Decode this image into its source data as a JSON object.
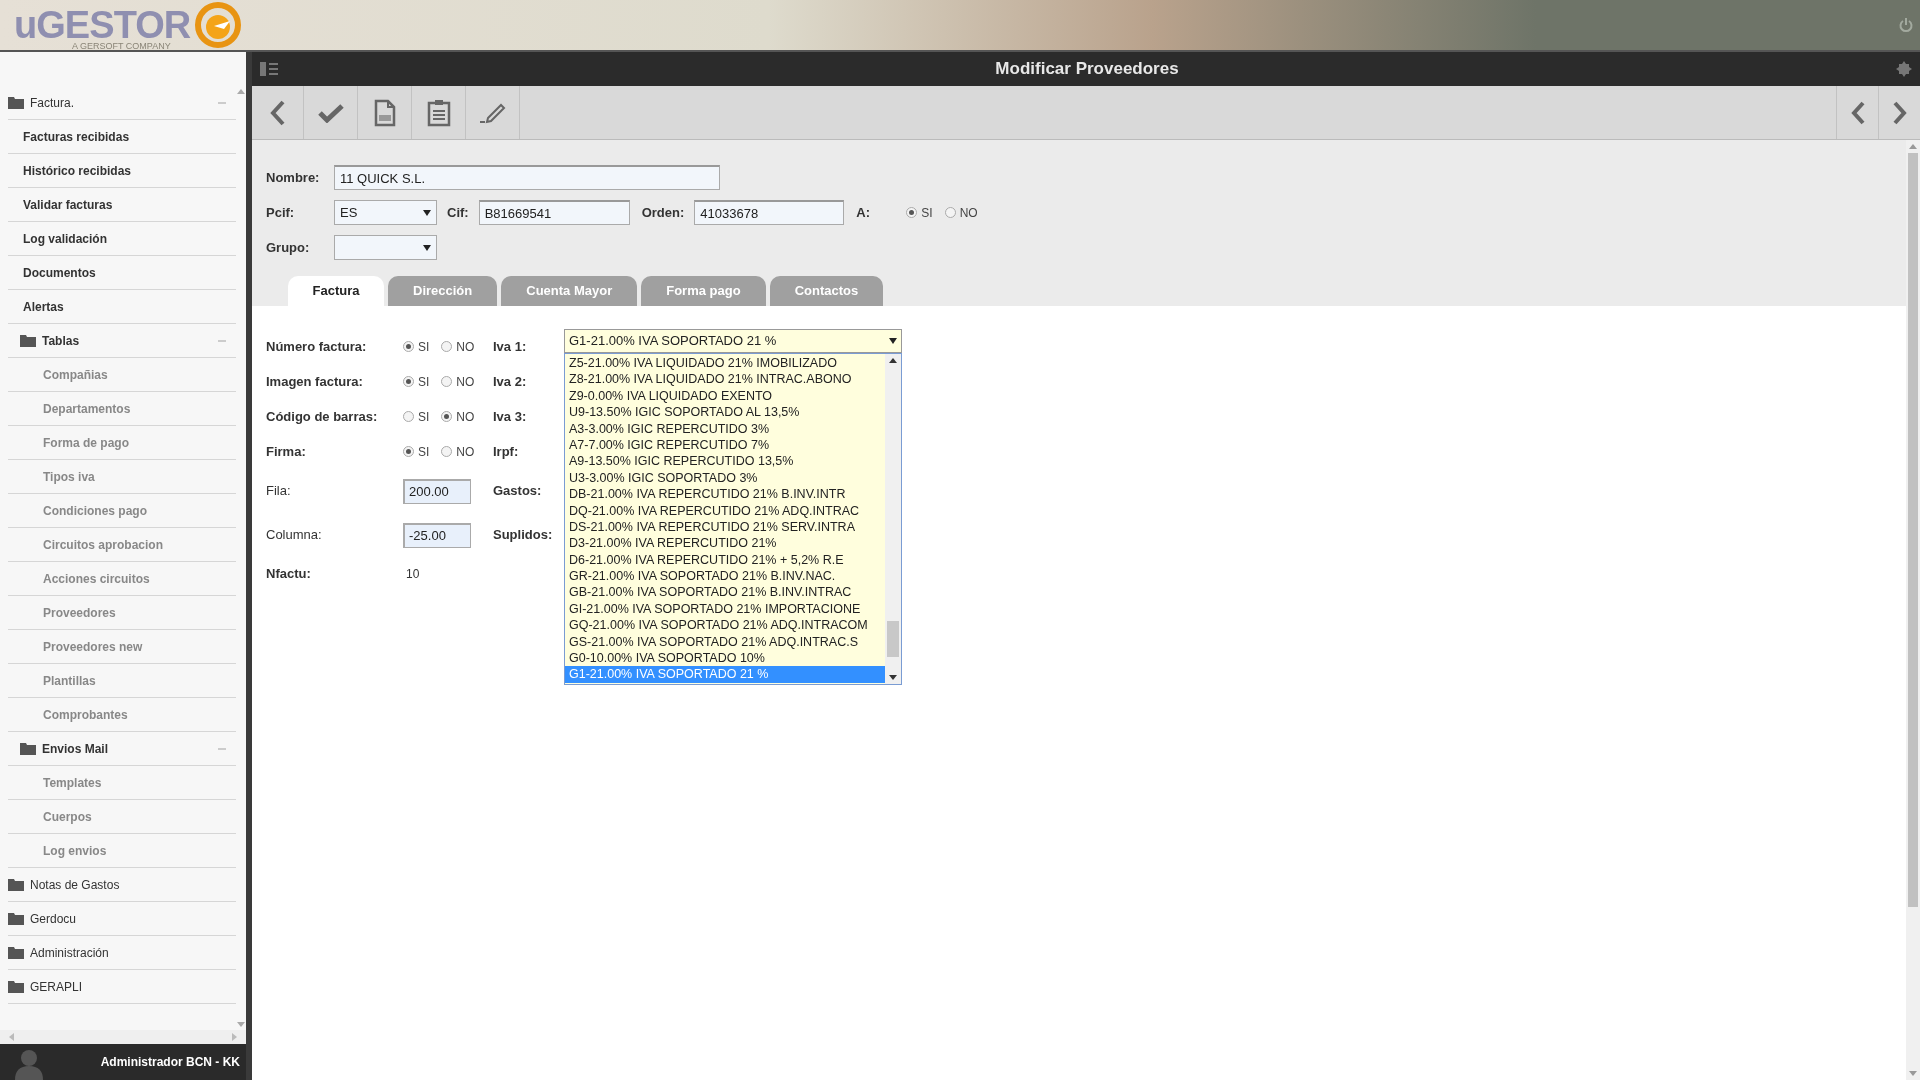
{
  "header": {
    "logo_text": "uGESTOR",
    "tagline": "A GERSOFT COMPANY"
  },
  "sidebar": {
    "items": [
      {
        "kind": "folder",
        "label": "Factura.",
        "expanded": true,
        "children": [
          {
            "kind": "item",
            "label": "Facturas recibidas"
          },
          {
            "kind": "item",
            "label": "Histórico recibidas"
          },
          {
            "kind": "item",
            "label": "Validar facturas"
          },
          {
            "kind": "item",
            "label": "Log validación"
          },
          {
            "kind": "item",
            "label": "Documentos"
          },
          {
            "kind": "item",
            "label": "Alertas"
          },
          {
            "kind": "folder",
            "label": "Tablas",
            "expanded": true,
            "children": [
              {
                "kind": "item",
                "label": "Compañias"
              },
              {
                "kind": "item",
                "label": "Departamentos"
              },
              {
                "kind": "item",
                "label": "Forma de pago"
              },
              {
                "kind": "item",
                "label": "Tipos iva"
              },
              {
                "kind": "item",
                "label": "Condiciones pago"
              },
              {
                "kind": "item",
                "label": "Circuitos aprobacion"
              },
              {
                "kind": "item",
                "label": "Acciones circuitos"
              },
              {
                "kind": "item",
                "label": "Proveedores"
              },
              {
                "kind": "item",
                "label": "Proveedores new"
              },
              {
                "kind": "item",
                "label": "Plantillas"
              },
              {
                "kind": "item",
                "label": "Comprobantes"
              }
            ]
          },
          {
            "kind": "folder",
            "label": "Envios Mail",
            "expanded": true,
            "children": [
              {
                "kind": "item",
                "label": "Templates"
              },
              {
                "kind": "item",
                "label": "Cuerpos"
              },
              {
                "kind": "item",
                "label": "Log envios"
              }
            ]
          }
        ]
      },
      {
        "kind": "folder",
        "label": "Notas de Gastos",
        "expanded": false
      },
      {
        "kind": "folder",
        "label": "Gerdocu",
        "expanded": false
      },
      {
        "kind": "folder",
        "label": "Administración",
        "expanded": false
      },
      {
        "kind": "folder",
        "label": "GERAPLI",
        "expanded": false
      }
    ],
    "user": "Administrador BCN - KK"
  },
  "title": "Modificar Proveedores",
  "form": {
    "nombre": {
      "label": "Nombre:",
      "value": "11 QUICK S.L."
    },
    "pcif": {
      "label": "Pcif:",
      "value": "ES"
    },
    "cif": {
      "label": "Cif:",
      "value": "B81669541"
    },
    "orden": {
      "label": "Orden:",
      "value": "41033678"
    },
    "a": {
      "label": "A:",
      "options": [
        {
          "label": "SI",
          "selected": true
        },
        {
          "label": "NO",
          "selected": false
        }
      ]
    },
    "grupo": {
      "label": "Grupo:"
    }
  },
  "tabs": [
    {
      "label": "Factura",
      "selected": true
    },
    {
      "label": "Dirección",
      "selected": false
    },
    {
      "label": "Cuenta Mayor",
      "selected": false
    },
    {
      "label": "Forma pago",
      "selected": false
    },
    {
      "label": "Contactos",
      "selected": false
    }
  ],
  "invoice_rows": [
    {
      "kind": "radio",
      "label": "Número factura:",
      "side_label": "Iva 1:",
      "options": [
        {
          "label": "SI",
          "selected": true
        },
        {
          "label": "NO",
          "selected": false
        }
      ]
    },
    {
      "kind": "radio",
      "label": "Imagen factura:",
      "side_label": "Iva 2:",
      "options": [
        {
          "label": "SI",
          "selected": true
        },
        {
          "label": "NO",
          "selected": false
        }
      ]
    },
    {
      "kind": "radio",
      "label": "Código de barras:",
      "side_label": "Iva 3:",
      "options": [
        {
          "label": "SI",
          "selected": false
        },
        {
          "label": "NO",
          "selected": true
        }
      ]
    },
    {
      "kind": "radio",
      "label": "Firma:",
      "side_label": "Irpf:",
      "options": [
        {
          "label": "SI",
          "selected": true
        },
        {
          "label": "NO",
          "selected": false
        }
      ]
    },
    {
      "kind": "input",
      "label": "Fila:",
      "side_label": "Gastos:",
      "value": "200.00"
    },
    {
      "kind": "input",
      "label": "Columna:",
      "side_label": "Suplidos:",
      "value": "-25.00"
    },
    {
      "kind": "text",
      "label": "Nfactu:",
      "value": "10"
    }
  ],
  "iva1": {
    "value": "G1-21.00% IVA SOPORTADO 21 %",
    "options": [
      {
        "text": "Z5-21.00% IVA LIQUIDADO 21% IMOBILIZADO",
        "selected": false
      },
      {
        "text": "Z8-21.00% IVA LIQUIDADO 21% INTRAC.ABONO",
        "selected": false
      },
      {
        "text": "Z9-0.00% IVA LIQUIDADO EXENTO",
        "selected": false
      },
      {
        "text": "U9-13.50% IGIC SOPORTADO AL 13,5%",
        "selected": false
      },
      {
        "text": "A3-3.00% IGIC REPERCUTIDO 3%",
        "selected": false
      },
      {
        "text": "A7-7.00% IGIC REPERCUTIDO 7%",
        "selected": false
      },
      {
        "text": "A9-13.50% IGIC REPERCUTIDO 13,5%",
        "selected": false
      },
      {
        "text": "U3-3.00% IGIC SOPORTADO 3%",
        "selected": false
      },
      {
        "text": "DB-21.00% IVA REPERCUTIDO 21% B.INV.INTR",
        "selected": false
      },
      {
        "text": "DQ-21.00% IVA REPERCUTIDO 21% ADQ.INTRAC",
        "selected": false
      },
      {
        "text": "DS-21.00% IVA REPERCUTIDO 21% SERV.INTRA",
        "selected": false
      },
      {
        "text": "D3-21.00% IVA REPERCUTIDO 21%",
        "selected": false
      },
      {
        "text": "D6-21.00% IVA REPERCUTIDO 21% + 5,2% R.E",
        "selected": false
      },
      {
        "text": "GR-21.00% IVA SOPORTADO 21% B.INV.NAC.",
        "selected": false
      },
      {
        "text": "GB-21.00% IVA SOPORTADO 21% B.INV.INTRAC",
        "selected": false
      },
      {
        "text": "GI-21.00% IVA SOPORTADO 21% IMPORTACIONE",
        "selected": false
      },
      {
        "text": "GQ-21.00% IVA SOPORTADO 21% ADQ.INTRACOM",
        "selected": false
      },
      {
        "text": "GS-21.00% IVA SOPORTADO 21% ADQ.INTRAC.S",
        "selected": false
      },
      {
        "text": "G0-10.00% IVA SOPORTADO 10%",
        "selected": false
      },
      {
        "text": "G1-21.00% IVA SOPORTADO 21 %",
        "selected": true
      }
    ]
  }
}
